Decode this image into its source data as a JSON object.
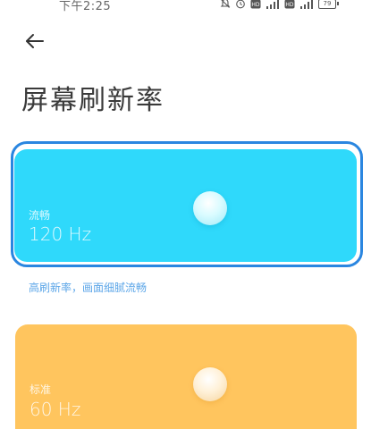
{
  "status_bar": {
    "time": "下午2:25",
    "icons": [
      "mute-icon",
      "alarm-icon",
      "hd-icon",
      "signal-icon",
      "hd-icon",
      "signal-icon",
      "battery-icon"
    ],
    "hd_label": "HD",
    "battery_level": "79"
  },
  "header": {
    "title": "屏幕刷新率"
  },
  "options": [
    {
      "label": "流畅",
      "value": "120 Hz",
      "description": "高刷新率，画面细腻流畅",
      "color": "#2fd9fb",
      "selected": true
    },
    {
      "label": "标准",
      "value": "60 Hz",
      "color": "#ffc55e",
      "selected": false
    }
  ],
  "colors": {
    "accent": "#2a86e0",
    "description": "#5ca6e8"
  }
}
